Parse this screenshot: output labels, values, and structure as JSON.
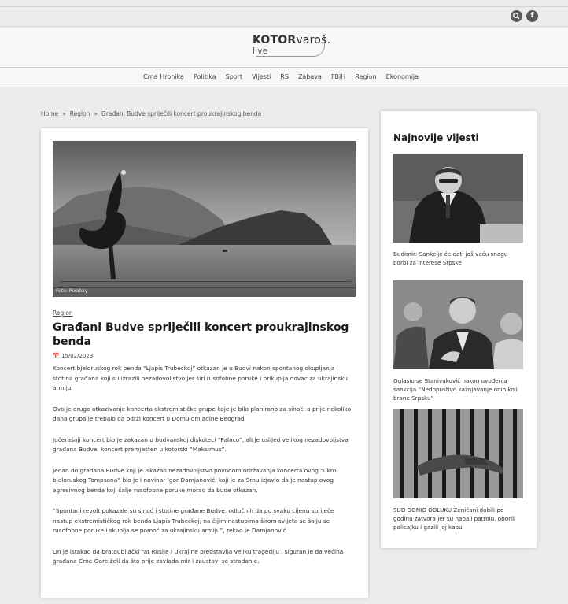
{
  "topbar": {
    "search_icon": "search-icon",
    "facebook_icon": "facebook-icon",
    "facebook_glyph": "f"
  },
  "logo": {
    "brand": "KOTOR",
    "brand_suffix": "varoš.",
    "sub": "live"
  },
  "nav": {
    "items": [
      "Crna Hronika",
      "Politika",
      "Sport",
      "Vijesti",
      "RS",
      "Zabava",
      "FBiH",
      "Region",
      "Ekonomija"
    ]
  },
  "breadcrumb": {
    "home": "Home",
    "sep": "»",
    "section": "Region",
    "current": "Građani Budve spriječili koncert proukrajinskog benda"
  },
  "article": {
    "image_credit": "Foto: Pixabay",
    "category": "Region",
    "title": "Građani Budve spriječili koncert proukrajinskog benda",
    "date": "15/02/2023",
    "paragraphs": [
      "Koncert bjeloruskog rok benda “Ljapis Trubeckoj” otkazan je u Budvi nakon spontanog okupljanja stotina građana koji su izrazili nezadovoljstvo jer širi rusofobne poruke i prikuplja novac za ukrajinsku armiju.",
      "Ovo je drugo otkazivanje koncerta ekstremističke grupe koje je bilo planirano za sinoć, a prije nekoliko dana grupa je trebalo da održi koncert u Domu omladine Beograd.",
      "Jučerašnji koncert bio je zakazan u budvanskoj diskoteci “Palaco”, ali je uslijed velikog nezadovoljstva građana Budve, koncert premješten u kotorski “Maksimus”.",
      "Jedan do građana Budve koji je iskazao nezadovoljstvo povodom održavanja koncerta ovog “ukro-bjeloruskog Tompsona” bio je i novinar Igor Damjanović, koji je za Srnu izjavio da je nastup ovog agresivnog benda koji šalje rusofobne poruke morao da bude otkazan.",
      "“Spontani revolt pokazale su sinoć i stotine građane Budve, odlučnih da po svaku cijenu spriječe nastup ekstremističkog rok benda Ljapis Trubeckoj, na čijim nastupima širom svijeta se šalju se rusofobne poruke i skuplja se pomoć za ukrajinsku armiju”, rekao je Damjanović.",
      "On je istakao da bratoubilački rat Rusije i Ukrajine predstavlja veliku tragediju i siguran je da većina građana Crne Gore želi da što prije zavlada mir i zaustavi se stradanje."
    ]
  },
  "sidebar": {
    "heading": "Najnovije vijesti",
    "items": [
      {
        "caption": "Budimir: Sankcije će dati još veću snagu borbi za interese Srpske"
      },
      {
        "caption": "Oglasio se Stanivuković nakon uvođenja sankcija “Nedopustivo kažnjavanje onih koji brane Srpsku”"
      },
      {
        "caption": "SUD DONIO ODLUKU Zeničani dobili po godinu zatvora jer su napali patrolu, oborili policajku i gazili joj kapu"
      }
    ]
  }
}
